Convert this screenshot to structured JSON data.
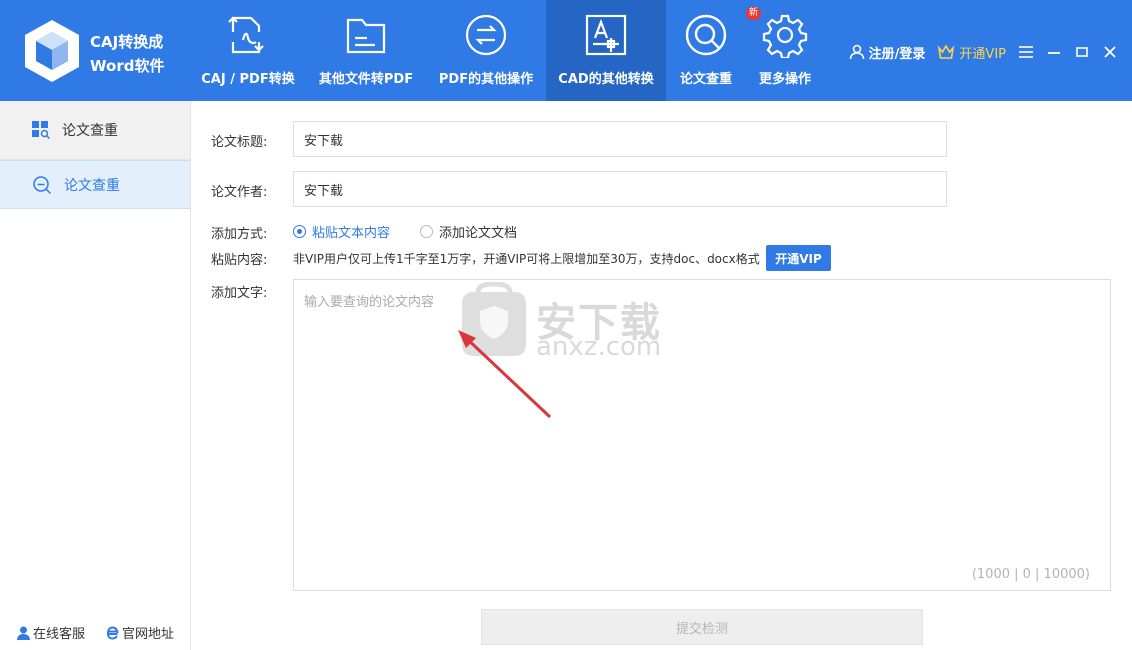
{
  "app": {
    "title_line1": "CAJ转换成",
    "title_line2": "Word软件"
  },
  "nav": [
    {
      "label": "CAJ / PDF转换",
      "icon": "pdf-convert-icon"
    },
    {
      "label": "其他文件转PDF",
      "icon": "file-to-pdf-icon"
    },
    {
      "label": "PDF的其他操作",
      "icon": "pdf-operations-icon"
    },
    {
      "label": "CAD的其他转换",
      "icon": "cad-convert-icon",
      "active": true
    },
    {
      "label": "论文查重",
      "icon": "plagiarism-check-icon",
      "badge": "新"
    },
    {
      "label": "更多操作",
      "icon": "gear-icon"
    }
  ],
  "header_right": {
    "login": "注册/登录",
    "vip": "开通VIP"
  },
  "sidebar": {
    "header": "论文查重",
    "item": "论文查重",
    "footer_service": "在线客服",
    "footer_site": "官网地址"
  },
  "form": {
    "title_label": "论文标题:",
    "title_value": "安下载",
    "author_label": "论文作者:",
    "author_value": "安下载",
    "method_label": "添加方式:",
    "method_options": [
      "粘贴文本内容",
      "添加论文文档"
    ],
    "paste_label": "粘贴内容:",
    "note": "非VIP用户仅可上传1千字至1万字，开通VIP可将上限增加至30万，支持doc、docx格式",
    "vip_button": "开通VIP",
    "text_label": "添加文字:",
    "text_placeholder": "输入要查询的论文内容",
    "counter": "(1000 | 0 | 10000)",
    "submit": "提交检测"
  },
  "watermark": {
    "text": "安下载",
    "sub": "anxz.com"
  },
  "colors": {
    "header_bg": "#2f7ae5",
    "nav_active_bg": "#2565c4",
    "accent": "#2f7ae5",
    "vip_gold": "#ffd54a",
    "badge_red": "#e53935"
  }
}
